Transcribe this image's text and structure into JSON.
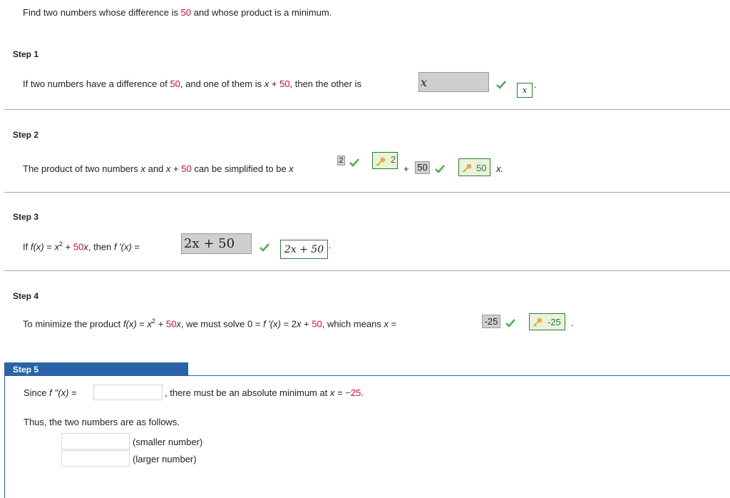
{
  "problem": {
    "pre": "Find two numbers whose difference is ",
    "value": "50",
    "post": " and whose product is a minimum."
  },
  "step1": {
    "title": "Step 1",
    "pre": "If two numbers have a difference of ",
    "diff": "50",
    "mid": ", and one of them is ",
    "expr_var": "x",
    "expr_plus": " + ",
    "expr_val": "50",
    "post": ", then the other is",
    "answer": "x",
    "key": "x",
    "trail": "."
  },
  "step2": {
    "title": "Step 2",
    "pre": "The product of two numbers ",
    "var": "x",
    "and": " and ",
    "var2": "x",
    "plus": " + ",
    "val": "50",
    "post": " can be simplified to be ",
    "var3": "x",
    "exp_answer": "2",
    "exp_key": "2",
    "plus2": "+",
    "coef_answer": "50",
    "coef_key": "50",
    "tail": "x."
  },
  "step3": {
    "title": "Step 3",
    "pre": "If ",
    "fx": "f(x)",
    "eq": " = ",
    "x": "x",
    "sq": "2",
    "plus": " + ",
    "val": "50",
    "x2": "x",
    "comma": ",  then ",
    "fpx": "f '(x)",
    "eq2": " =",
    "answer": "2x + 50",
    "key": "2x + 50",
    "trail": "."
  },
  "step4": {
    "title": "Step 4",
    "pre": "To minimize the product ",
    "fx": "f(x)",
    "eq": " = ",
    "x": "x",
    "sq": "2",
    "plus": " + ",
    "val": "50",
    "x2": "x",
    "mid": ",  we must solve  0 = ",
    "fpx": "f '(x)",
    "eq2": " = 2",
    "x3": "x",
    "plus2": " + ",
    "val2": "50",
    "means": ",  which means ",
    "x4": "x",
    "eq3": " =",
    "answer": "-25",
    "key": "-25",
    "trail": "."
  },
  "step5": {
    "title": "Step 5",
    "since": "Since ",
    "fpp": "f ''(x)",
    "eq": " =",
    "mid": ", there must be an absolute minimum at ",
    "x": "x",
    "eq2": " = ",
    "val": "−25",
    "trail": ".",
    "thus": "Thus, the two numbers are as follows.",
    "smaller": "(smaller number)",
    "larger": "(larger number)"
  },
  "colors": {
    "accent": "#c8102e",
    "correct": "#2e7d32",
    "step_bar": "#2a63a6"
  },
  "icons": {
    "check": "check-icon",
    "key": "key-icon"
  }
}
